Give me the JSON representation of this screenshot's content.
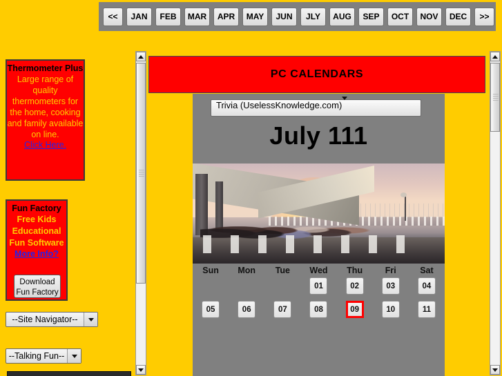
{
  "toolbar": {
    "prev_label": "<<",
    "next_label": ">>",
    "months": [
      "JAN",
      "FEB",
      "MAR",
      "APR",
      "MAY",
      "JUN",
      "JLY",
      "AUG",
      "SEP",
      "OCT",
      "NOV",
      "DEC"
    ]
  },
  "sidebar": {
    "thermometer_ad": {
      "title": "Thermometer Plus",
      "body": "Large range of quality thermometers for the home, cooking and family available on line.",
      "link": "Click Here."
    },
    "funfactory_ad": {
      "title": "Fun Factory",
      "body": "Free Kids Educational Fun Software",
      "link": "More Info?",
      "download_label": "Download Fun Factory"
    },
    "site_navigator": {
      "value": "--Site Navigator--"
    },
    "talking_fun": {
      "value": "--Talking Fun--"
    }
  },
  "main": {
    "banner_title": "PC CALENDARS",
    "feed_select": {
      "value": "Trivia (UselessKnowledge.com)"
    },
    "month_title": "July 111",
    "weekdays": [
      "Sun",
      "Mon",
      "Tue",
      "Wed",
      "Thu",
      "Fri",
      "Sat"
    ],
    "week1": [
      "",
      "",
      "",
      "01",
      "02",
      "03",
      "04"
    ],
    "week2": [
      "05",
      "06",
      "07",
      "08",
      "09",
      "10",
      "11"
    ],
    "today": "09"
  },
  "colors": {
    "page_background": "#FFCC00",
    "toolbar_background": "#808080",
    "banner_red": "#FF0000",
    "calendar_panel_gray": "#808080",
    "ad_text_yellow": "#FFCC00",
    "link_blue": "#2222EE"
  }
}
